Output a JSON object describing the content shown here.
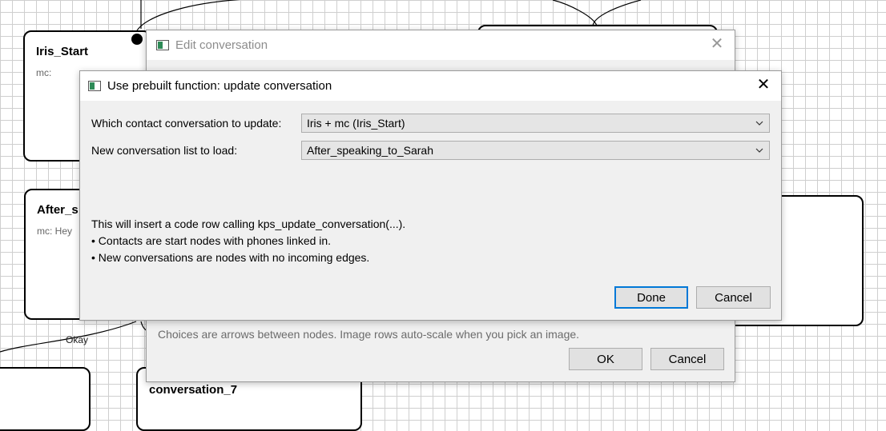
{
  "canvas": {
    "nodes": [
      {
        "title": "Iris_Start",
        "subtitle": "mc:"
      },
      {
        "title": "After_s",
        "subtitle": "mc: Hey"
      },
      {
        "title": "conversation_7",
        "subtitle": ""
      }
    ],
    "edge_label": "Okay"
  },
  "edit_dialog": {
    "title": "Edit conversation",
    "hint": "Choices are arrows between nodes. Image rows auto-scale when you pick an image.",
    "ok_label": "OK",
    "cancel_label": "Cancel"
  },
  "prebuilt_dialog": {
    "title": "Use prebuilt function: update conversation",
    "contact_label": "Which contact conversation to update:",
    "contact_value": "Iris + mc (Iris_Start)",
    "list_label": "New conversation list to load:",
    "list_value": "After_speaking_to_Sarah",
    "info_lines": [
      "This will insert a code row calling kps_update_conversation(...).",
      "• Contacts are start nodes with phones linked in.",
      "• New conversations are nodes with no incoming edges."
    ],
    "done_label": "Done",
    "cancel_label": "Cancel"
  },
  "icons": {
    "close": "close-icon",
    "chevron": "chevron-down-icon",
    "app": "app-window-icon"
  },
  "colors": {
    "accent": "#0078d7",
    "dialog_bg": "#f0f0f0"
  }
}
